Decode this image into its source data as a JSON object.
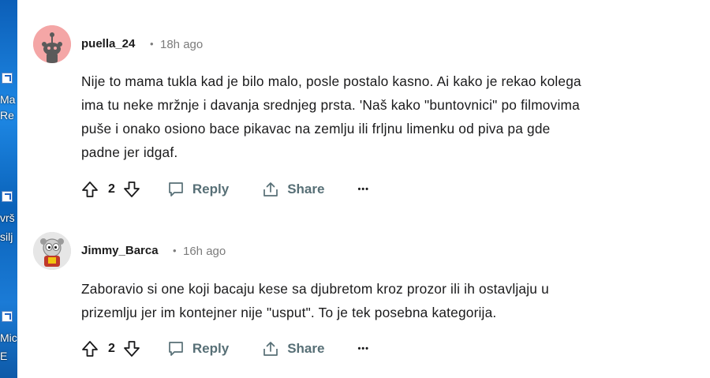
{
  "desktop": {
    "labels": [
      "Ma",
      "Re",
      "vrš",
      "silj",
      "Mic",
      "E"
    ]
  },
  "comments": [
    {
      "username": "puella_24",
      "separator": "•",
      "time": "18h ago",
      "lines": [
        "Nije to mama tukla kad je bilo malo, posle postalo kasno. Ai kako je rekao kolega",
        "ima tu neke mržnje i davanja srednjeg prsta. 'Naš kako \"buntovnici\" po filmovima",
        "puše i onako osiono bace pikavac na zemlju ili frljnu limenku od piva pa gde",
        "padne jer idgaf."
      ],
      "votes": "2",
      "reply_label": "Reply",
      "share_label": "Share",
      "more_label": "•••",
      "avatar_color": "#f3a3a3"
    },
    {
      "username": "Jimmy_Barca",
      "separator": "•",
      "time": "16h ago",
      "lines": [
        "Zaboravio si one koji bacaju kese sa djubretom kroz prozor ili ih ostavljaju u",
        "prizemlju jer im kontejner nije \"usput\". To je tek posebna kategorija."
      ],
      "votes": "2",
      "reply_label": "Reply",
      "share_label": "Share",
      "more_label": "•••",
      "avatar_color": "#d9d9d9"
    }
  ]
}
